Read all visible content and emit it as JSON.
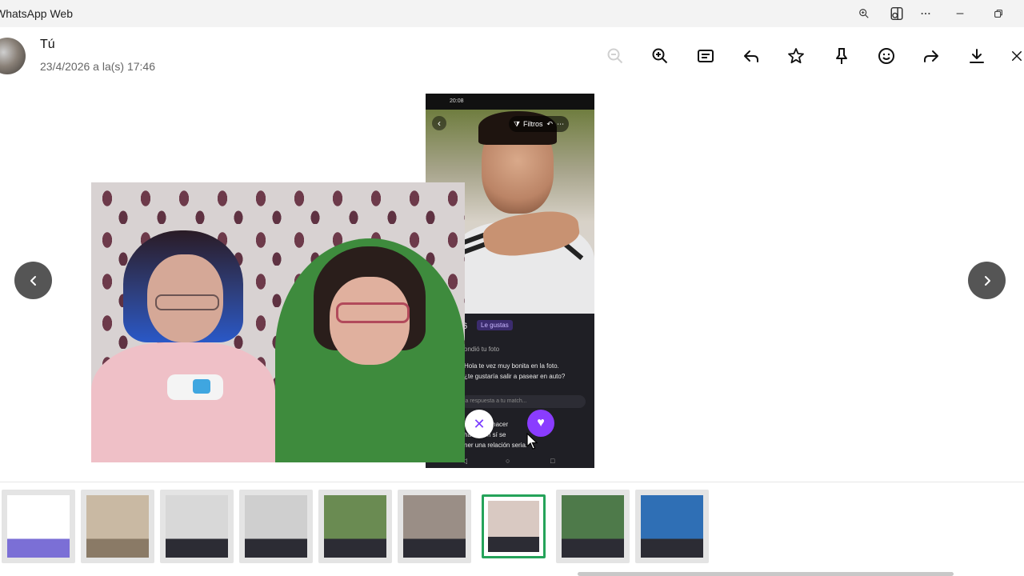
{
  "window": {
    "title": "WhatsApp Web",
    "buttons": [
      "zoom-icon",
      "app-view-icon",
      "more-icon",
      "minimize-icon",
      "restore-icon"
    ]
  },
  "viewer": {
    "sender": "Tú",
    "timestamp": "23/4/2026 a la(s) 17:46",
    "toolbar": [
      "zoom-out-icon",
      "zoom-in-icon",
      "caption-icon",
      "reply-icon",
      "star-icon",
      "pin-icon",
      "react-icon",
      "forward-icon",
      "download-icon",
      "close-icon"
    ]
  },
  "phone_screenshot": {
    "status": "20:08",
    "filter_label": "Filtros",
    "profile_suffix": "6",
    "badge": "Le gustas",
    "chat_lines": [
      "ondió tu foto",
      "Hola te vez muy bonita en la foto.",
      "¿te gustaría salir a pasear en auto?",
      "me gusta      hacer",
      "hacer am      sí se",
      "ner una relación seria."
    ],
    "input_placeholder": "la respuesta a tu match..."
  },
  "thumbnails": [
    {
      "label": "thumbnail-1",
      "colors": [
        "#ffffff",
        "#7b6fd6"
      ]
    },
    {
      "label": "thumbnail-2",
      "colors": [
        "#c9b9a3",
        "#8a7a66"
      ]
    },
    {
      "label": "thumbnail-3",
      "colors": [
        "#d8d8d8",
        "#2c2c34"
      ]
    },
    {
      "label": "thumbnail-4",
      "colors": [
        "#cfcfcf",
        "#2c2c34"
      ]
    },
    {
      "label": "thumbnail-5",
      "colors": [
        "#6a8b52",
        "#2c2c34"
      ]
    },
    {
      "label": "thumbnail-6",
      "colors": [
        "#9a8e86",
        "#2c2c34"
      ]
    },
    {
      "label": "thumbnail-7",
      "colors": [
        "#d9c9c2",
        "#2c2c34"
      ],
      "selected": true
    },
    {
      "label": "thumbnail-8",
      "colors": [
        "#4e7a4a",
        "#2c2c34"
      ]
    },
    {
      "label": "thumbnail-9",
      "colors": [
        "#2f6fb5",
        "#2c2c34"
      ]
    }
  ]
}
